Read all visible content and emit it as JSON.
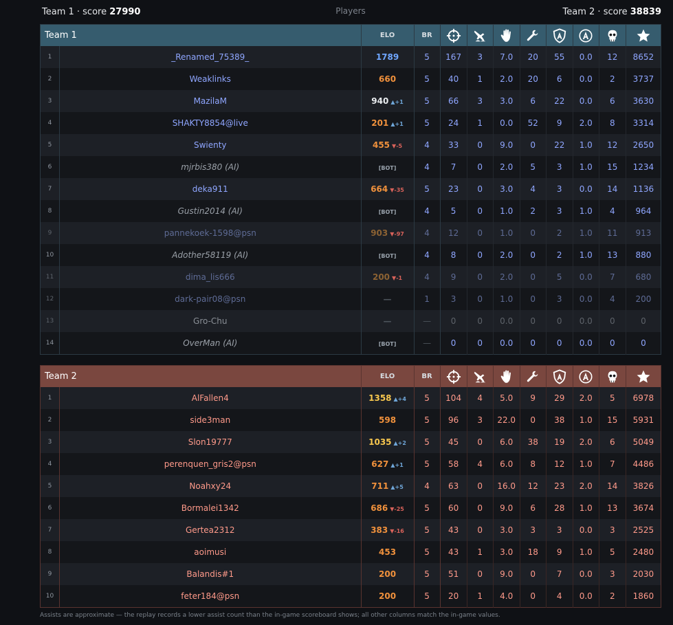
{
  "header": {
    "team1_label": "Team 1 · score",
    "team1_score": "27990",
    "players_label": "Players",
    "team2_label": "Team 2 · score",
    "team2_score": "38839"
  },
  "columns": {
    "elo": "ELO",
    "br": "BR",
    "icons": [
      "crosshair-icon",
      "plane-shot-down-icon",
      "hand-icon",
      "wrench-icon",
      "shield-a-icon",
      "circle-a-icon",
      "skull-icon",
      "star-icon"
    ]
  },
  "colors": {
    "team1_header": "#365c6e",
    "team2_header": "#7a473f",
    "elo_high": "#6fa6ff",
    "elo_low": "#f0913c",
    "team2_top_elo": "#f6c64e"
  },
  "team1": {
    "name": "Team 1",
    "rows": [
      {
        "rank": "1",
        "name": "_Renamed_75389_",
        "elo": "1789",
        "delta": "",
        "br": "5",
        "v": [
          "167",
          "3",
          "7.0",
          "20",
          "55",
          "0.0",
          "12",
          "8652"
        ],
        "ai": false,
        "state": "",
        "eloc": "blue"
      },
      {
        "rank": "2",
        "name": "Weaklinks",
        "elo": "660",
        "delta": "",
        "br": "5",
        "v": [
          "40",
          "1",
          "2.0",
          "20",
          "6",
          "0.0",
          "2",
          "3737"
        ],
        "ai": false,
        "state": "",
        "eloc": "orange"
      },
      {
        "rank": "3",
        "name": "MazilaM",
        "elo": "940",
        "delta": "▲+1",
        "br": "5",
        "v": [
          "66",
          "3",
          "3.0",
          "6",
          "22",
          "0.0",
          "6",
          "3630"
        ],
        "ai": false,
        "state": "",
        "eloc": "white"
      },
      {
        "rank": "4",
        "name": "SHAKTY8854@live",
        "elo": "201",
        "delta": "▲+1",
        "br": "5",
        "v": [
          "24",
          "1",
          "0.0",
          "52",
          "9",
          "2.0",
          "8",
          "3314"
        ],
        "ai": false,
        "state": "",
        "eloc": "orange"
      },
      {
        "rank": "5",
        "name": "Swienty",
        "elo": "455",
        "delta": "▼-5",
        "br": "4",
        "v": [
          "33",
          "0",
          "9.0",
          "0",
          "22",
          "1.0",
          "12",
          "2650"
        ],
        "ai": false,
        "state": "",
        "eloc": "orange"
      },
      {
        "rank": "6",
        "name": "mjrbis380 (AI)",
        "elo": "[BOT]",
        "delta": "",
        "br": "4",
        "v": [
          "7",
          "0",
          "2.0",
          "5",
          "3",
          "1.0",
          "15",
          "1234"
        ],
        "ai": true,
        "state": "bot",
        "eloc": "bot"
      },
      {
        "rank": "7",
        "name": "deka911",
        "elo": "664",
        "delta": "▼-35",
        "br": "5",
        "v": [
          "23",
          "0",
          "3.0",
          "4",
          "3",
          "0.0",
          "14",
          "1136"
        ],
        "ai": false,
        "state": "",
        "eloc": "orange"
      },
      {
        "rank": "8",
        "name": "Gustin2014 (AI)",
        "elo": "[BOT]",
        "delta": "",
        "br": "4",
        "v": [
          "5",
          "0",
          "1.0",
          "2",
          "3",
          "1.0",
          "4",
          "964"
        ],
        "ai": true,
        "state": "bot",
        "eloc": "bot"
      },
      {
        "rank": "9",
        "name": "pannekoek-1598@psn",
        "elo": "903",
        "delta": "▼-97",
        "br": "4",
        "v": [
          "12",
          "0",
          "1.0",
          "0",
          "2",
          "1.0",
          "11",
          "913"
        ],
        "ai": false,
        "state": "dim",
        "eloc": "dim"
      },
      {
        "rank": "10",
        "name": "Adother58119 (AI)",
        "elo": "[BOT]",
        "delta": "",
        "br": "4",
        "v": [
          "8",
          "0",
          "2.0",
          "0",
          "2",
          "1.0",
          "13",
          "880"
        ],
        "ai": true,
        "state": "bot",
        "eloc": "bot"
      },
      {
        "rank": "11",
        "name": "dima_lis666",
        "elo": "200",
        "delta": "▼-1",
        "br": "4",
        "v": [
          "9",
          "0",
          "2.0",
          "0",
          "5",
          "0.0",
          "7",
          "680"
        ],
        "ai": false,
        "state": "dim",
        "eloc": "dim"
      },
      {
        "rank": "12",
        "name": "dark-pair08@psn",
        "elo": "—",
        "delta": "",
        "br": "1",
        "v": [
          "3",
          "0",
          "1.0",
          "0",
          "3",
          "0.0",
          "4",
          "200"
        ],
        "ai": false,
        "state": "dim",
        "eloc": "dash"
      },
      {
        "rank": "13",
        "name": "Gro-Chu",
        "elo": "—",
        "delta": "",
        "br": "—",
        "v": [
          "0",
          "0",
          "0.0",
          "0",
          "0",
          "0.0",
          "0",
          "0"
        ],
        "ai": false,
        "state": "faint",
        "eloc": "dash"
      },
      {
        "rank": "14",
        "name": "OverMan (AI)",
        "elo": "[BOT]",
        "delta": "",
        "br": "—",
        "v": [
          "0",
          "0",
          "0.0",
          "0",
          "0",
          "0.0",
          "0",
          "0"
        ],
        "ai": true,
        "state": "bot",
        "eloc": "bot"
      }
    ]
  },
  "team2": {
    "name": "Team 2",
    "rows": [
      {
        "rank": "1",
        "name": "AlFallen4",
        "elo": "1358",
        "delta": "▲+4",
        "br": "5",
        "v": [
          "104",
          "4",
          "5.0",
          "9",
          "29",
          "2.0",
          "5",
          "6978"
        ],
        "eloc": "gold"
      },
      {
        "rank": "2",
        "name": "side3man",
        "elo": "598",
        "delta": "",
        "br": "5",
        "v": [
          "96",
          "3",
          "22.0",
          "0",
          "38",
          "1.0",
          "15",
          "5931"
        ],
        "eloc": "orange"
      },
      {
        "rank": "3",
        "name": "Slon19777",
        "elo": "1035",
        "delta": "▲+2",
        "br": "5",
        "v": [
          "45",
          "0",
          "6.0",
          "38",
          "19",
          "2.0",
          "6",
          "5049"
        ],
        "eloc": "gold"
      },
      {
        "rank": "4",
        "name": "perenquen_gris2@psn",
        "elo": "627",
        "delta": "▲+1",
        "br": "5",
        "v": [
          "58",
          "4",
          "6.0",
          "8",
          "12",
          "1.0",
          "7",
          "4486"
        ],
        "eloc": "orange"
      },
      {
        "rank": "5",
        "name": "Noahxy24",
        "elo": "711",
        "delta": "▲+5",
        "br": "4",
        "v": [
          "63",
          "0",
          "16.0",
          "12",
          "23",
          "2.0",
          "14",
          "3826"
        ],
        "eloc": "orange"
      },
      {
        "rank": "6",
        "name": "Bormalei1342",
        "elo": "686",
        "delta": "▼-25",
        "br": "5",
        "v": [
          "60",
          "0",
          "9.0",
          "6",
          "28",
          "1.0",
          "13",
          "3674"
        ],
        "eloc": "orange"
      },
      {
        "rank": "7",
        "name": "Gertea2312",
        "elo": "383",
        "delta": "▼-16",
        "br": "5",
        "v": [
          "43",
          "0",
          "3.0",
          "3",
          "3",
          "0.0",
          "3",
          "2525"
        ],
        "eloc": "orange"
      },
      {
        "rank": "8",
        "name": "aoimusi",
        "elo": "453",
        "delta": "",
        "br": "5",
        "v": [
          "43",
          "1",
          "3.0",
          "18",
          "9",
          "1.0",
          "5",
          "2480"
        ],
        "eloc": "orange"
      },
      {
        "rank": "9",
        "name": "Balandis#1",
        "elo": "200",
        "delta": "",
        "br": "5",
        "v": [
          "51",
          "0",
          "9.0",
          "0",
          "7",
          "0.0",
          "3",
          "2030"
        ],
        "eloc": "orange"
      },
      {
        "rank": "10",
        "name": "feter184@psn",
        "elo": "200",
        "delta": "",
        "br": "5",
        "v": [
          "20",
          "1",
          "4.0",
          "0",
          "4",
          "0.0",
          "2",
          "1860"
        ],
        "eloc": "orange"
      }
    ]
  },
  "footnote": "Assists are approximate — the replay records a lower assist count than the in-game scoreboard shows; all other columns match the in-game values."
}
